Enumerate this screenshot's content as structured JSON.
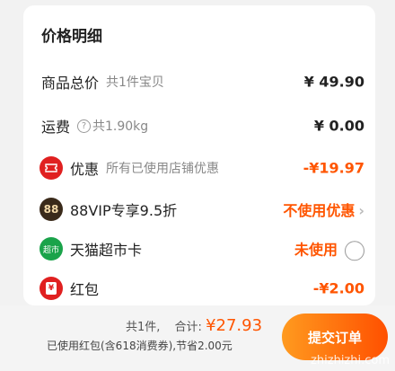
{
  "card": {
    "title": "价格明细"
  },
  "rows": {
    "goods_total": {
      "label": "商品总价",
      "sub": "共1件宝贝",
      "amount": "¥ 49.90"
    },
    "shipping": {
      "label": "运费",
      "sub": "共1.90kg",
      "amount": "¥ 0.00"
    },
    "discount": {
      "label": "优惠",
      "sub": "所有已使用店铺优惠",
      "amount": "-¥19.97"
    },
    "vip": {
      "badge": "88",
      "label": "88VIP专享9.5折",
      "action": "不使用优惠"
    },
    "tmall_card": {
      "badge": "超市",
      "label": "天猫超市卡",
      "action": "未使用"
    },
    "red_packet": {
      "badge": "¥",
      "label": "红包",
      "amount": "-¥2.00"
    }
  },
  "footer": {
    "count": "共1件,",
    "total_label": "合计:",
    "total": "¥27.93",
    "note": "已使用红包(含618消费券),节省2.00元",
    "submit": "提交订单"
  },
  "watermark": "zhizhizhi.com",
  "colors": {
    "accent": "#ff5500",
    "vip_badge": "#3a2a1a",
    "tmall_badge": "#1aa34a",
    "red_badge": "#e02020"
  }
}
